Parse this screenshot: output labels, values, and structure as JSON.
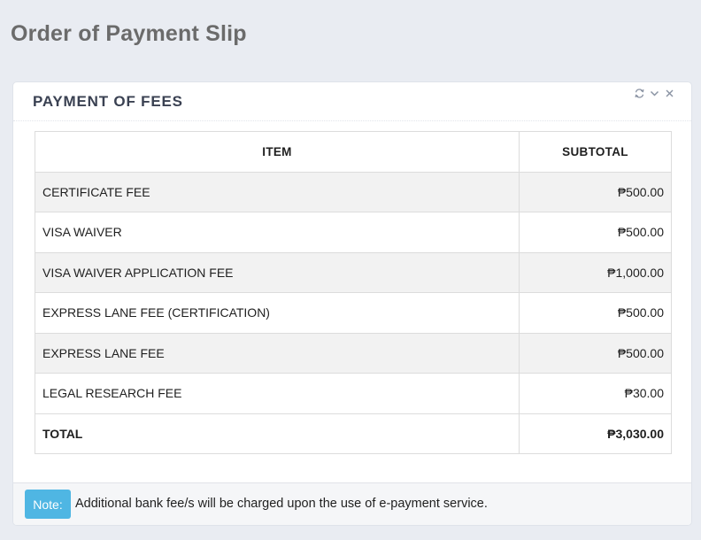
{
  "page": {
    "title": "Order of Payment Slip"
  },
  "card": {
    "title": "PAYMENT OF FEES",
    "tools": [
      "refresh-icon",
      "chevron-down-icon",
      "close-icon"
    ]
  },
  "table": {
    "headers": {
      "item": "ITEM",
      "subtotal": "SUBTOTAL"
    },
    "rows": [
      {
        "item": "CERTIFICATE FEE",
        "subtotal": "₱500.00"
      },
      {
        "item": "VISA WAIVER",
        "subtotal": "₱500.00"
      },
      {
        "item": "VISA WAIVER APPLICATION FEE",
        "subtotal": "₱1,000.00"
      },
      {
        "item": "EXPRESS LANE FEE (CERTIFICATION)",
        "subtotal": "₱500.00"
      },
      {
        "item": "EXPRESS LANE FEE",
        "subtotal": "₱500.00"
      },
      {
        "item": "LEGAL RESEARCH FEE",
        "subtotal": "₱30.00"
      }
    ],
    "total": {
      "label": "TOTAL",
      "amount": "₱3,030.00"
    }
  },
  "footer": {
    "note_label": "Note:",
    "note_text": "Additional bank fee/s will be charged upon the use of e-payment service."
  },
  "colors": {
    "note_badge": "#4fb6e3",
    "page_background": "#e9ecf2"
  }
}
